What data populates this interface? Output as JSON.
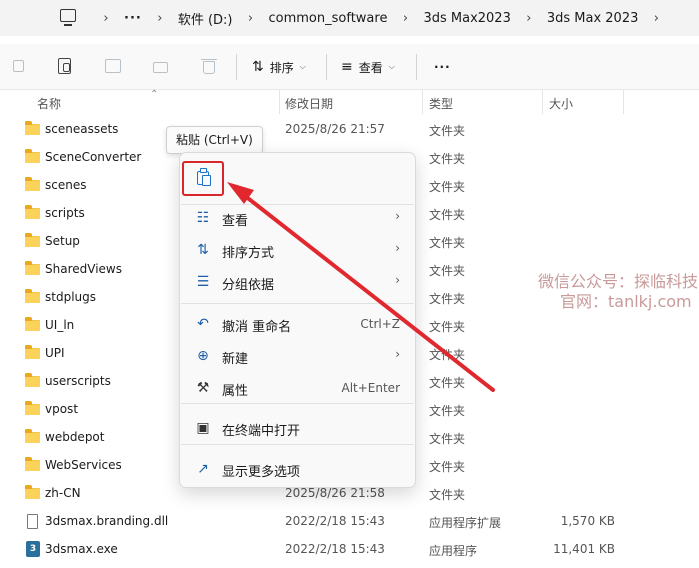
{
  "breadcrumb": {
    "more": "···",
    "items": [
      "软件 (D:)",
      "common_software",
      "3ds Max2023",
      "3ds Max 2023"
    ]
  },
  "toolbar": {
    "sort_label": "排序",
    "view_label": "查看",
    "more": "···"
  },
  "columns": {
    "name": "名称",
    "date": "修改日期",
    "type": "类型",
    "size": "大小"
  },
  "files": [
    {
      "name": "sceneassets",
      "date": "2025/8/26 21:57",
      "type": "文件夹",
      "size": "",
      "kind": "folder"
    },
    {
      "name": "SceneConverter",
      "date": "",
      "type": "文件夹",
      "size": "",
      "kind": "folder"
    },
    {
      "name": "scenes",
      "date": "",
      "type": "文件夹",
      "size": "",
      "kind": "folder"
    },
    {
      "name": "scripts",
      "date": "",
      "type": "文件夹",
      "size": "",
      "kind": "folder"
    },
    {
      "name": "Setup",
      "date": "",
      "type": "文件夹",
      "size": "",
      "kind": "folder"
    },
    {
      "name": "SharedViews",
      "date": "",
      "type": "文件夹",
      "size": "",
      "kind": "folder"
    },
    {
      "name": "stdplugs",
      "date": "",
      "type": "文件夹",
      "size": "",
      "kind": "folder"
    },
    {
      "name": "UI_ln",
      "date": "",
      "type": "文件夹",
      "size": "",
      "kind": "folder"
    },
    {
      "name": "UPI",
      "date": "",
      "type": "文件夹",
      "size": "",
      "kind": "folder"
    },
    {
      "name": "userscripts",
      "date": "",
      "type": "文件夹",
      "size": "",
      "kind": "folder"
    },
    {
      "name": "vpost",
      "date": "",
      "type": "文件夹",
      "size": "",
      "kind": "folder"
    },
    {
      "name": "webdepot",
      "date": "",
      "type": "文件夹",
      "size": "",
      "kind": "folder"
    },
    {
      "name": "WebServices",
      "date": "",
      "type": "文件夹",
      "size": "",
      "kind": "folder"
    },
    {
      "name": "zh-CN",
      "date": "2025/8/26 21:58",
      "type": "文件夹",
      "size": "",
      "kind": "folder"
    },
    {
      "name": "3dsmax.branding.dll",
      "date": "2022/2/18 15:43",
      "type": "应用程序扩展",
      "size": "1,570 KB",
      "kind": "dll"
    },
    {
      "name": "3dsmax.exe",
      "date": "2022/2/18 15:43",
      "type": "应用程序",
      "size": "11,401 KB",
      "kind": "exe"
    }
  ],
  "tooltip": "粘贴 (Ctrl+V)",
  "context_menu": {
    "items": [
      {
        "label": "查看",
        "icon": "grid-icon",
        "submenu": true,
        "shortcut": ""
      },
      {
        "label": "排序方式",
        "icon": "sort-icon",
        "submenu": true,
        "shortcut": ""
      },
      {
        "label": "分组依据",
        "icon": "group-icon",
        "submenu": true,
        "shortcut": ""
      },
      {
        "label": "撤消 重命名",
        "icon": "undo-icon",
        "submenu": false,
        "shortcut": "Ctrl+Z"
      },
      {
        "label": "新建",
        "icon": "new-icon",
        "submenu": true,
        "shortcut": ""
      },
      {
        "label": "属性",
        "icon": "wrench-icon",
        "submenu": false,
        "shortcut": "Alt+Enter"
      },
      {
        "label": "在终端中打开",
        "icon": "terminal-icon",
        "submenu": false,
        "shortcut": ""
      },
      {
        "label": "显示更多选项",
        "icon": "share-icon",
        "submenu": false,
        "shortcut": ""
      }
    ]
  },
  "watermark": {
    "line1": "微信公众号：探临科技",
    "line2": "官网：tanlkj.com"
  },
  "colors": {
    "highlight_red": "#d8262a",
    "accent_blue": "#1f5fa8",
    "folder_yellow": "#f5c344"
  }
}
